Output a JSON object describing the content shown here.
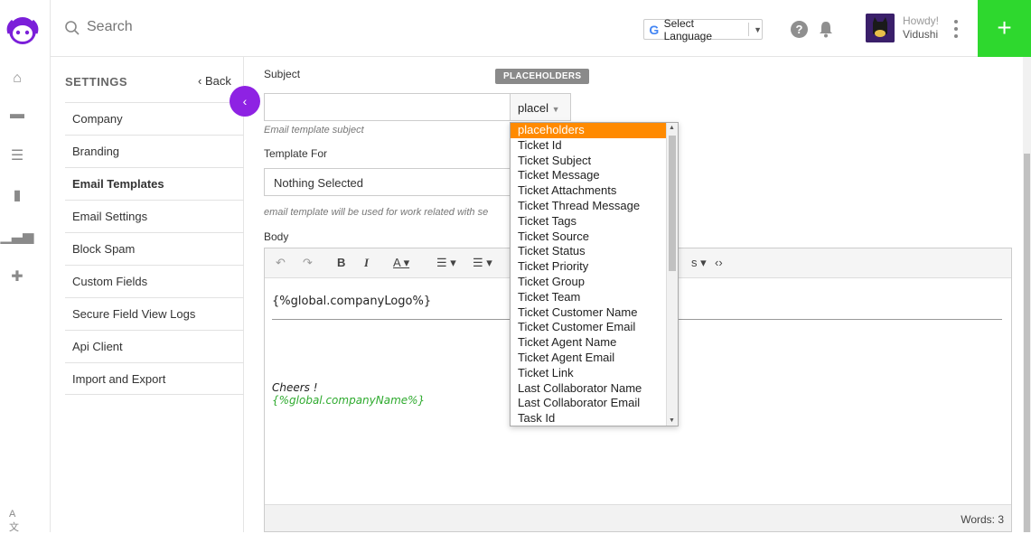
{
  "topbar": {
    "search_placeholder": "Search",
    "language_label": "Select Language",
    "help_label": "?",
    "howdy": "Howdy!",
    "username": "Vidushi",
    "plus_label": "+"
  },
  "settings": {
    "heading": "SETTINGS",
    "back_label": "Back",
    "items": [
      {
        "label": "Company"
      },
      {
        "label": "Branding"
      },
      {
        "label": "Email Templates"
      },
      {
        "label": "Email Settings"
      },
      {
        "label": "Block Spam"
      },
      {
        "label": "Custom Fields"
      },
      {
        "label": "Secure Field View Logs"
      },
      {
        "label": "Api Client"
      },
      {
        "label": "Import and Export"
      }
    ]
  },
  "form": {
    "subject_label": "Subject",
    "placeholders_badge": "PLACEHOLDERS",
    "placeholder_select_value": "placel",
    "subject_hint": "Email template subject",
    "template_for_label": "Template For",
    "template_for_value": "Nothing Selected",
    "template_for_hint": "email template will be used for work related with se",
    "body_label": "Body"
  },
  "editor": {
    "toolbar_text": "s",
    "logo_placeholder": "{%global.companyLogo%}",
    "cheers": "Cheers !",
    "company_placeholder": "{%global.companyName%}",
    "words": "Words: 3"
  },
  "dropdown": {
    "items": [
      "placeholders",
      "Ticket Id",
      "Ticket Subject",
      "Ticket Message",
      "Ticket Attachments",
      "Ticket Thread Message",
      "Ticket Tags",
      "Ticket Source",
      "Ticket Status",
      "Ticket Priority",
      "Ticket Group",
      "Ticket Team",
      "Ticket Customer Name",
      "Ticket Customer Email",
      "Ticket Agent Name",
      "Ticket Agent Email",
      "Ticket Link",
      "Last Collaborator Name",
      "Last Collaborator Email",
      "Task Id"
    ]
  },
  "colors": {
    "accent_green": "#2ed82e",
    "collapse_purple": "#8e22e3",
    "dropdown_selected": "#ff8a00",
    "placeholder_green": "#2eaa2e"
  }
}
